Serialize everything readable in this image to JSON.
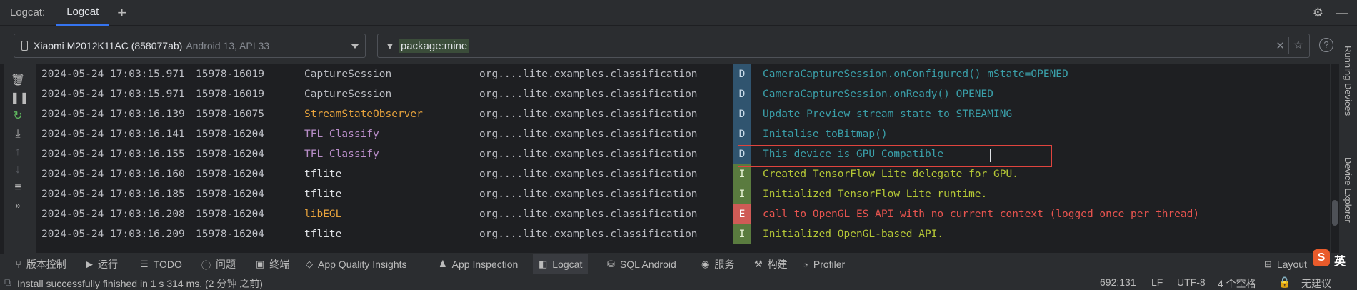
{
  "tabbar": {
    "panel_title": "Logcat:",
    "active_tab": "Logcat",
    "add_tab_icon": "plus-icon",
    "settings_icon": "gear-icon",
    "minimize_icon": "minimize-icon"
  },
  "filters": {
    "device_name": "Xiaomi M2012K11AC (858077ab)",
    "device_api": "Android 13, API 33",
    "query": "package:mine"
  },
  "logs": [
    {
      "time": "2024-05-24 17:03:15.971",
      "pid": "15978-16019",
      "tag": "CaptureSession",
      "tag_color": "#bcbec4",
      "pkg": "org....lite.examples.classification",
      "level": "D",
      "msg": "CameraCaptureSession.onConfigured() mState=OPENED"
    },
    {
      "time": "2024-05-24 17:03:15.971",
      "pid": "15978-16019",
      "tag": "CaptureSession",
      "tag_color": "#bcbec4",
      "pkg": "org....lite.examples.classification",
      "level": "D",
      "msg": "CameraCaptureSession.onReady() OPENED"
    },
    {
      "time": "2024-05-24 17:03:16.139",
      "pid": "15978-16075",
      "tag": "StreamStateObserver",
      "tag_color": "#e6a23c",
      "pkg": "org....lite.examples.classification",
      "level": "D",
      "msg": "Update Preview stream state to STREAMING"
    },
    {
      "time": "2024-05-24 17:03:16.141",
      "pid": "15978-16204",
      "tag": "TFL Classify",
      "tag_color": "#b98ec9",
      "pkg": "org....lite.examples.classification",
      "level": "D",
      "msg": "Initalise toBitmap()"
    },
    {
      "time": "2024-05-24 17:03:16.155",
      "pid": "15978-16204",
      "tag": "TFL Classify",
      "tag_color": "#b98ec9",
      "pkg": "org....lite.examples.classification",
      "level": "D",
      "msg": "This device is GPU Compatible"
    },
    {
      "time": "2024-05-24 17:03:16.160",
      "pid": "15978-16204",
      "tag": "tflite",
      "tag_color": "#dfe1e5",
      "pkg": "org....lite.examples.classification",
      "level": "I",
      "msg": "Created TensorFlow Lite delegate for GPU."
    },
    {
      "time": "2024-05-24 17:03:16.185",
      "pid": "15978-16204",
      "tag": "tflite",
      "tag_color": "#dfe1e5",
      "pkg": "org....lite.examples.classification",
      "level": "I",
      "msg": "Initialized TensorFlow Lite runtime."
    },
    {
      "time": "2024-05-24 17:03:16.208",
      "pid": "15978-16204",
      "tag": "libEGL",
      "tag_color": "#e6a23c",
      "pkg": "org....lite.examples.classification",
      "level": "E",
      "msg": "call to OpenGL ES API with no current context (logged once per thread)"
    },
    {
      "time": "2024-05-24 17:03:16.209",
      "pid": "15978-16204",
      "tag": "tflite",
      "tag_color": "#dfe1e5",
      "pkg": "org....lite.examples.classification",
      "level": "I",
      "msg": "Initialized OpenGL-based API."
    }
  ],
  "side_right": {
    "running_devices": "Running Devices",
    "device_explorer": "Device Explorer"
  },
  "tool_windows": [
    {
      "label": "版本控制",
      "icon": "branch-icon"
    },
    {
      "label": "运行",
      "icon": "run-icon"
    },
    {
      "label": "TODO",
      "icon": "list-icon"
    },
    {
      "label": "问题",
      "icon": "warning-icon"
    },
    {
      "label": "终端",
      "icon": "terminal-icon"
    },
    {
      "label": "App Quality Insights",
      "icon": "diamond-icon"
    },
    {
      "label": "App Inspection",
      "icon": "inspect-icon"
    },
    {
      "label": "Logcat",
      "icon": "logcat-icon"
    },
    {
      "label": "SQL Android",
      "icon": "database-icon"
    },
    {
      "label": "服务",
      "icon": "services-icon"
    },
    {
      "label": "构建",
      "icon": "hammer-icon"
    },
    {
      "label": "Profiler",
      "icon": "gauge-icon"
    }
  ],
  "layout_inspector": "Layout",
  "status": {
    "message": "Install successfully finished in 1 s 314 ms. (2 分钟 之前)",
    "position": "692:131",
    "line_sep": "LF",
    "encoding": "UTF-8",
    "indent": "4 个空格",
    "suggestion": "无建议"
  },
  "ime": {
    "badge": "S",
    "label": "英"
  },
  "colors": {
    "debug_bg": "#30546f",
    "info_bg": "#5a7b3f",
    "error_bg": "#cf5b56",
    "highlight": "#e0443e",
    "accent": "#3574f0"
  }
}
